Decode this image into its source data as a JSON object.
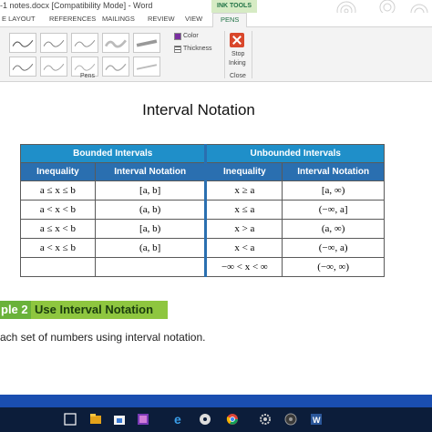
{
  "window": {
    "title": "-1 notes.docx [Compatibility Mode] - Word",
    "context_tab_group": "INK TOOLS"
  },
  "tabs": [
    {
      "label": "E LAYOUT"
    },
    {
      "label": "REFERENCES"
    },
    {
      "label": "MAILINGS"
    },
    {
      "label": "REVIEW"
    },
    {
      "label": "VIEW"
    },
    {
      "label": "PENS",
      "active": true
    }
  ],
  "ribbon": {
    "pens_group_label": "Pens",
    "color_label": "Color",
    "thickness_label": "Thickness",
    "stop_inking_line1": "Stop",
    "stop_inking_line2": "Inking",
    "close_group_label": "Close"
  },
  "document": {
    "heading": "Interval Notation",
    "table": {
      "group_headers": [
        "Bounded Intervals",
        "Unbounded Intervals"
      ],
      "column_headers": [
        "Inequality",
        "Interval Notation",
        "Inequality",
        "Interval Notation"
      ],
      "rows": [
        [
          "a ≤ x ≤ b",
          "[a, b]",
          "x ≥ a",
          "[a, ∞)"
        ],
        [
          "a < x < b",
          "(a, b)",
          "x ≤ a",
          "(−∞, a]"
        ],
        [
          "a ≤ x < b",
          "[a, b)",
          "x > a",
          "(a, ∞)"
        ],
        [
          "a < x ≤ b",
          "(a, b]",
          "x < a",
          "(−∞, a)"
        ],
        [
          "",
          "",
          "−∞ < x < ∞",
          "(−∞, ∞)"
        ]
      ]
    },
    "example_number": "ple 2",
    "example_title": "Use Interval Notation",
    "instruction": "ach set of numbers using interval notation."
  },
  "taskbar": {
    "icons": [
      "start-icon",
      "task-view-icon",
      "file-explorer-icon",
      "store-icon",
      "app-icon",
      "edge-icon",
      "media-icon",
      "chrome-icon",
      "settings-icon",
      "app2-icon",
      "word-icon"
    ]
  }
}
